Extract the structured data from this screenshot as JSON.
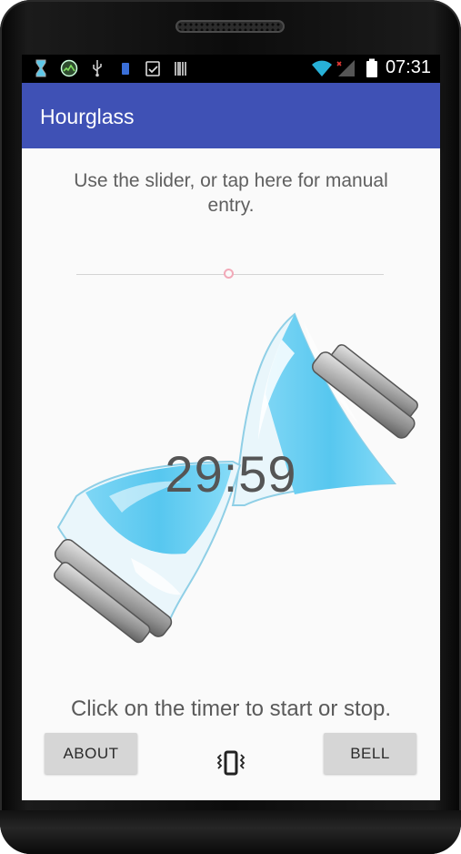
{
  "status_bar": {
    "time": "07:31",
    "left_icons": [
      "hourglass-icon",
      "app-notification-icon",
      "usb-icon",
      "sim-icon",
      "clipboard-check-icon",
      "barcode-icon"
    ],
    "right_icons": [
      "wifi-icon",
      "cell-signal-icon",
      "battery-icon"
    ]
  },
  "app_bar": {
    "title": "Hourglass"
  },
  "main": {
    "instruction": "Use the slider, or tap here for manual entry.",
    "timer": "29:59",
    "hint": "Click on the timer to start or stop."
  },
  "buttons": {
    "about": "ABOUT",
    "bell": "BELL",
    "vibrate_icon": "vibrate-icon"
  },
  "colors": {
    "app_bar": "#3f51b5",
    "sand": "#5ecbf2",
    "slider_thumb": "#f2a9b8"
  }
}
